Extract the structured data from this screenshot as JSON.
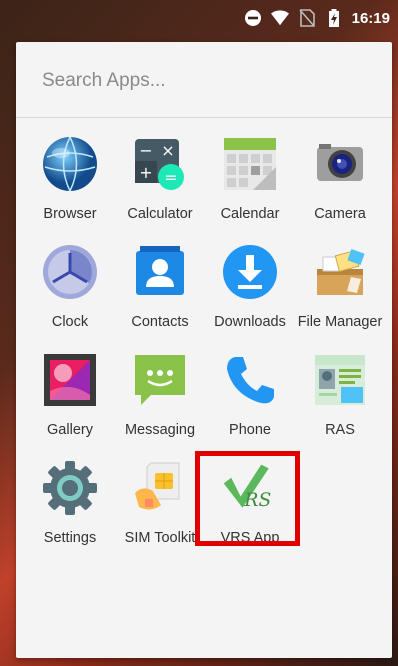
{
  "status_bar": {
    "time": "16:19",
    "icons": [
      "do-not-disturb-icon",
      "wifi-icon",
      "no-sim-icon",
      "battery-charging-icon"
    ]
  },
  "search": {
    "placeholder": "Search Apps..."
  },
  "apps": [
    {
      "label": "Browser",
      "icon": "browser-globe-icon"
    },
    {
      "label": "Calculator",
      "icon": "calculator-icon"
    },
    {
      "label": "Calendar",
      "icon": "calendar-icon"
    },
    {
      "label": "Camera",
      "icon": "camera-icon"
    },
    {
      "label": "Clock",
      "icon": "clock-icon"
    },
    {
      "label": "Contacts",
      "icon": "contacts-icon"
    },
    {
      "label": "Downloads",
      "icon": "download-icon"
    },
    {
      "label": "File Manager",
      "icon": "file-manager-icon"
    },
    {
      "label": "Gallery",
      "icon": "gallery-icon"
    },
    {
      "label": "Messaging",
      "icon": "messaging-icon"
    },
    {
      "label": "Phone",
      "icon": "phone-icon"
    },
    {
      "label": "RAS",
      "icon": "ras-icon"
    },
    {
      "label": "Settings",
      "icon": "settings-gear-icon"
    },
    {
      "label": "SIM Toolkit",
      "icon": "sim-card-icon"
    },
    {
      "label": "VRS App",
      "icon": "vrs-checkmark-icon"
    }
  ],
  "colors": {
    "highlight": "#e00000",
    "panel": "#f4f4f4"
  }
}
